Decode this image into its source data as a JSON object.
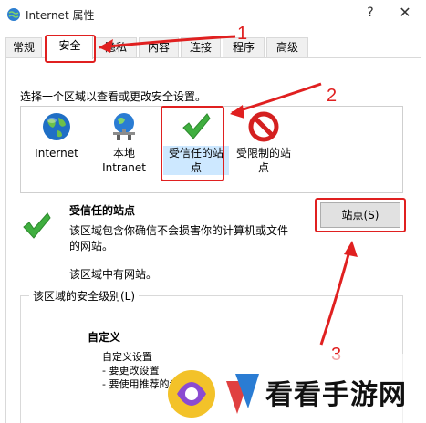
{
  "window": {
    "title": "Internet 属性",
    "help_glyph": "?",
    "close_glyph": "✕"
  },
  "tabs": [
    {
      "label": "常规"
    },
    {
      "label": "安全"
    },
    {
      "label": "隐私"
    },
    {
      "label": "内容"
    },
    {
      "label": "连接"
    },
    {
      "label": "程序"
    },
    {
      "label": "高级"
    }
  ],
  "active_tab": "安全",
  "zone_prompt": "选择一个区域以查看或更改安全设置。",
  "zones": [
    {
      "label": "Internet",
      "icon": "globe-icon"
    },
    {
      "label": "本地\nIntranet",
      "icon": "intranet-icon"
    },
    {
      "label": "受信任的站\n点",
      "icon": "check-icon"
    },
    {
      "label": "受限制的站\n点",
      "icon": "restricted-icon"
    }
  ],
  "selected_zone": "受信任的站点",
  "detail": {
    "title": "受信任的站点",
    "description": "该区域包含你确信不会损害你的计算机或文件的网站。",
    "note": "该区域中有网站。"
  },
  "sites_button": "站点(S)",
  "security_level": {
    "legend": "该区域的安全级别(L)",
    "name": "自定义",
    "text": "自定义设置\n- 要更改设置\n- 要使用推荐的设置"
  },
  "annotations": {
    "num1": "1",
    "num2": "2",
    "num3": "3",
    "color": "#e02020"
  },
  "watermark": {
    "text": "看看手游网"
  }
}
